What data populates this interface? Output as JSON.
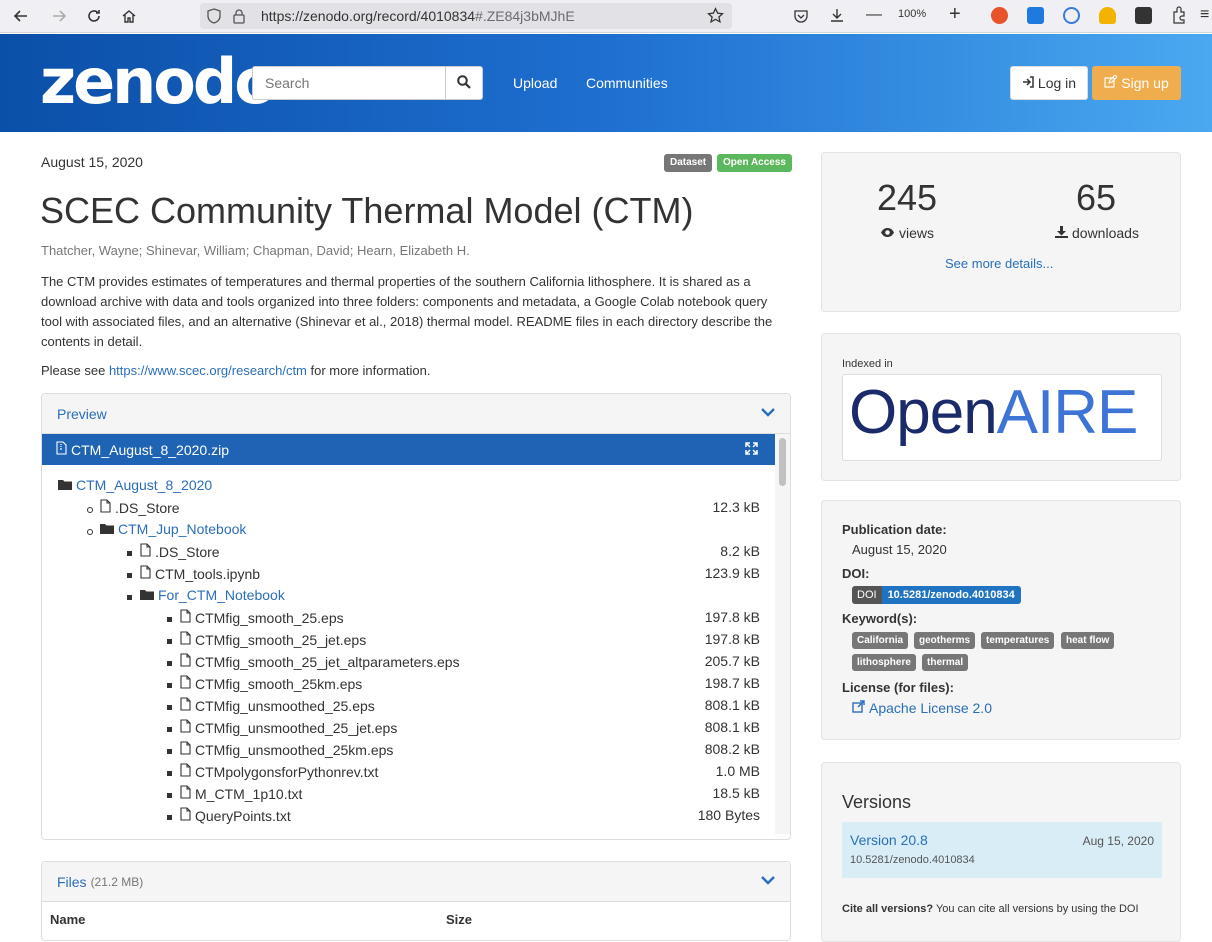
{
  "browser": {
    "url_main": "https://zenodo.org/record/4010834",
    "url_hash": "#.ZE84j3bMJhE",
    "zoom": "100%"
  },
  "header": {
    "logo": "zenodo",
    "search_placeholder": "Search",
    "upload": "Upload",
    "communities": "Communities",
    "login": "Log in",
    "signup": "Sign up"
  },
  "record": {
    "date": "August 15, 2020",
    "badge_type": "Dataset",
    "badge_access": "Open Access",
    "title": "SCEC Community Thermal Model (CTM)",
    "authors": "Thatcher, Wayne; Shinevar, William; Chapman, David; Hearn, Elizabeth H.",
    "description": "The CTM provides estimates of temperatures and thermal properties of the southern California lithosphere. It is shared as a download archive with data and tools organized into three folders: components and metadata, a Google Colab notebook query tool with associated files, and an alternative (Shinevar et al., 2018) thermal model. README files in each directory describe the contents in detail.",
    "see_prefix": "Please see ",
    "see_link": "https://www.scec.org/research/ctm",
    "see_suffix": " for more information."
  },
  "preview": {
    "heading": "Preview",
    "zip_name": "CTM_August_8_2020.zip",
    "tree": [
      {
        "name": "CTM_August_8_2020",
        "type": "folder",
        "size": ""
      },
      {
        "name": ".DS_Store",
        "type": "file",
        "size": "12.3 kB"
      },
      {
        "name": "CTM_Jup_Notebook",
        "type": "folder",
        "size": ""
      },
      {
        "name": ".DS_Store",
        "type": "file",
        "size": "8.2 kB"
      },
      {
        "name": "CTM_tools.ipynb",
        "type": "file",
        "size": "123.9 kB"
      },
      {
        "name": "For_CTM_Notebook",
        "type": "folder",
        "size": ""
      },
      {
        "name": "CTMfig_smooth_25.eps",
        "type": "file",
        "size": "197.8 kB"
      },
      {
        "name": "CTMfig_smooth_25_jet.eps",
        "type": "file",
        "size": "197.8 kB"
      },
      {
        "name": "CTMfig_smooth_25_jet_altparameters.eps",
        "type": "file",
        "size": "205.7 kB"
      },
      {
        "name": "CTMfig_smooth_25km.eps",
        "type": "file",
        "size": "198.7 kB"
      },
      {
        "name": "CTMfig_unsmoothed_25.eps",
        "type": "file",
        "size": "808.1 kB"
      },
      {
        "name": "CTMfig_unsmoothed_25_jet.eps",
        "type": "file",
        "size": "808.1 kB"
      },
      {
        "name": "CTMfig_unsmoothed_25km.eps",
        "type": "file",
        "size": "808.2 kB"
      },
      {
        "name": "CTMpolygonsforPythonrev.txt",
        "type": "file",
        "size": "1.0 MB"
      },
      {
        "name": "M_CTM_1p10.txt",
        "type": "file",
        "size": "18.5 kB"
      },
      {
        "name": "QueryPoints.txt",
        "type": "file",
        "size": "180 Bytes"
      }
    ]
  },
  "files": {
    "heading": "Files",
    "size": "(21.2 MB)",
    "col_name": "Name",
    "col_size": "Size"
  },
  "stats": {
    "views": "245",
    "views_label": "views",
    "downloads": "65",
    "downloads_label": "downloads",
    "more": "See more details..."
  },
  "indexed": {
    "label": "Indexed in",
    "logo_dark": "Open",
    "logo_light": "AIRE"
  },
  "meta": {
    "pub_label": "Publication date:",
    "pub_value": "August 15, 2020",
    "doi_label": "DOI:",
    "doi_key": "DOI",
    "doi_value": "10.5281/zenodo.4010834",
    "kw_label": "Keyword(s):",
    "keywords": [
      "California",
      "geotherms",
      "temperatures",
      "heat flow",
      "lithosphere",
      "thermal"
    ],
    "license_label": "License (for files):",
    "license": "Apache License 2.0"
  },
  "versions": {
    "heading": "Versions",
    "version": "Version 20.8",
    "version_date": "Aug 15, 2020",
    "version_doi": "10.5281/zenodo.4010834",
    "cite_bold": "Cite all versions?",
    "cite_text": " You can cite all versions by using the DOI"
  },
  "colors": {
    "header_start": "#0b4fa8",
    "header_end": "#4aa8f0",
    "link": "#2a6ebb",
    "signup": "#f0ad4e",
    "badge_dataset": "#777777",
    "badge_open": "#5cb85c"
  }
}
